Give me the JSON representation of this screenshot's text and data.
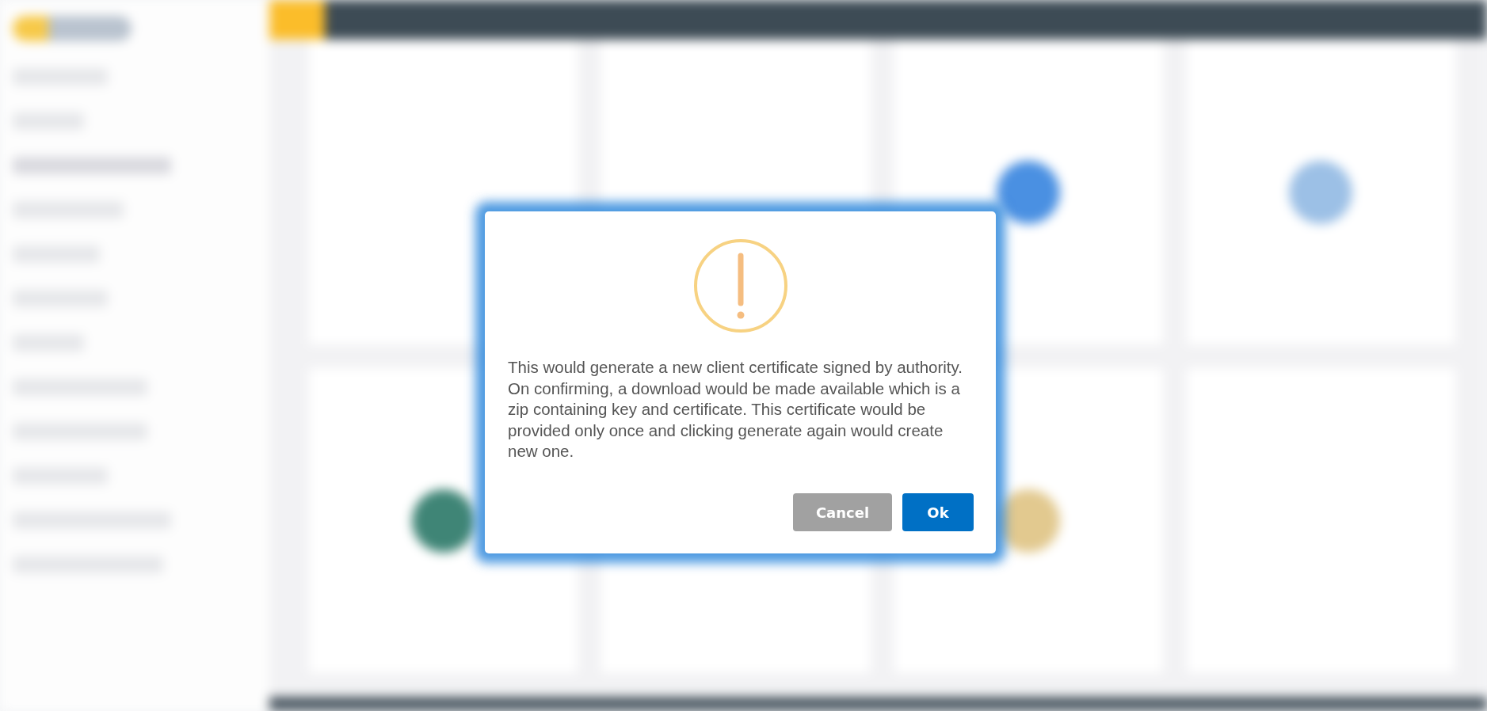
{
  "dialog": {
    "message": "This would generate a new client certificate signed by authority. On confirming, a download would be made available which is a zip containing key and certificate. This certificate would be provided only once and clicking generate again would create new one.",
    "buttons": [
      {
        "label": "Cancel",
        "kind": "secondary"
      },
      {
        "label": "Ok",
        "kind": "primary"
      }
    ]
  }
}
